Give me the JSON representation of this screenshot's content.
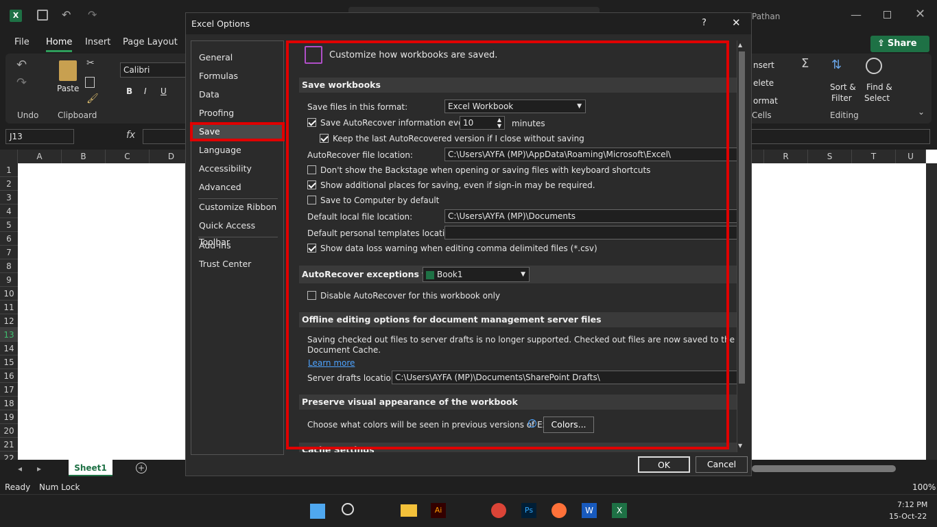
{
  "excel": {
    "menu_tabs": [
      "File",
      "Home",
      "Insert",
      "Page Layout"
    ],
    "user_name": "Pathan",
    "share_label": "Share",
    "groups": {
      "undo": "Undo",
      "clipboard": "Clipboard",
      "cells": "Cells",
      "editing": "Editing"
    },
    "paste_label": "Paste",
    "font_name": "Calibri",
    "cells_items": [
      "nsert",
      "elete",
      "ormat"
    ],
    "sort_label": "Sort &",
    "filter_label": "Filter",
    "find_label": "Find &",
    "select_label": "Select",
    "name_box": "J13",
    "columns_left": [
      "A",
      "B",
      "C",
      "D"
    ],
    "columns_right": [
      "R",
      "S",
      "T",
      "U"
    ],
    "rows": [
      "1",
      "2",
      "3",
      "4",
      "5",
      "6",
      "7",
      "8",
      "9",
      "10",
      "11",
      "12",
      "13",
      "14",
      "15",
      "16",
      "17",
      "18",
      "19",
      "20",
      "21",
      "22"
    ],
    "sheet_tab": "Sheet1",
    "status_ready": "Ready",
    "status_numlock": "Num Lock",
    "zoom": "100%",
    "clock_time": "7:12 PM",
    "clock_date": "15-Oct-22"
  },
  "dialog": {
    "title": "Excel Options",
    "help": "?",
    "nav": [
      "General",
      "Formulas",
      "Data",
      "Proofing",
      "Save",
      "Language",
      "Accessibility",
      "Advanced",
      "Customize Ribbon",
      "Quick Access Toolbar",
      "Add-ins",
      "Trust Center"
    ],
    "selected_nav": "Save",
    "header_text": "Customize how workbooks are saved.",
    "section_save": "Save workbooks",
    "format_label": "Save files in this format:",
    "format_value": "Excel Workbook",
    "autorecover_label": "Save AutoRecover information every",
    "autorecover_value": "10",
    "minutes_label": "minutes",
    "keep_last_label": "Keep the last AutoRecovered version if I close without saving",
    "ar_location_label": "AutoRecover file location:",
    "ar_location_value": "C:\\Users\\AYFA (MP)\\AppData\\Roaming\\Microsoft\\Excel\\",
    "backstage_label": "Don't show the Backstage when opening or saving files with keyboard shortcuts",
    "additional_places_label": "Show additional places for saving, even if sign-in may be required.",
    "save_to_computer_label": "Save to Computer by default",
    "default_local_label": "Default local file location:",
    "default_local_value": "C:\\Users\\AYFA (MP)\\Documents",
    "templates_label": "Default personal templates location:",
    "templates_value": "",
    "csv_warning_label": "Show data loss warning when editing comma delimited files (*.csv)",
    "section_exceptions": "AutoRecover exceptions for:",
    "exceptions_value": "Book1",
    "disable_ar_label": "Disable AutoRecover for this workbook only",
    "section_offline": "Offline editing options for document management server files",
    "offline_text_1": "Saving checked out files to server drafts is no longer supported. Checked out files are now saved to the Office",
    "offline_text_2": "Document Cache.",
    "learn_more": "Learn more",
    "server_drafts_label": "Server drafts location:",
    "server_drafts_value": "C:\\Users\\AYFA (MP)\\Documents\\SharePoint Drafts\\",
    "section_preserve": "Preserve visual appearance of the workbook",
    "colors_label": "Choose what colors will be seen in previous versions of Excel:",
    "colors_button": "Colors...",
    "section_cache": "Cache Settings",
    "ok": "OK",
    "cancel": "Cancel",
    "checks": {
      "autorecover": true,
      "keep_last": true,
      "backstage": false,
      "additional_places": true,
      "save_to_computer": false,
      "csv_warning": true,
      "disable_ar": false
    }
  },
  "colors": {
    "highlight": "#e00000",
    "accent_green": "#1e7145",
    "link": "#4da3ff"
  }
}
